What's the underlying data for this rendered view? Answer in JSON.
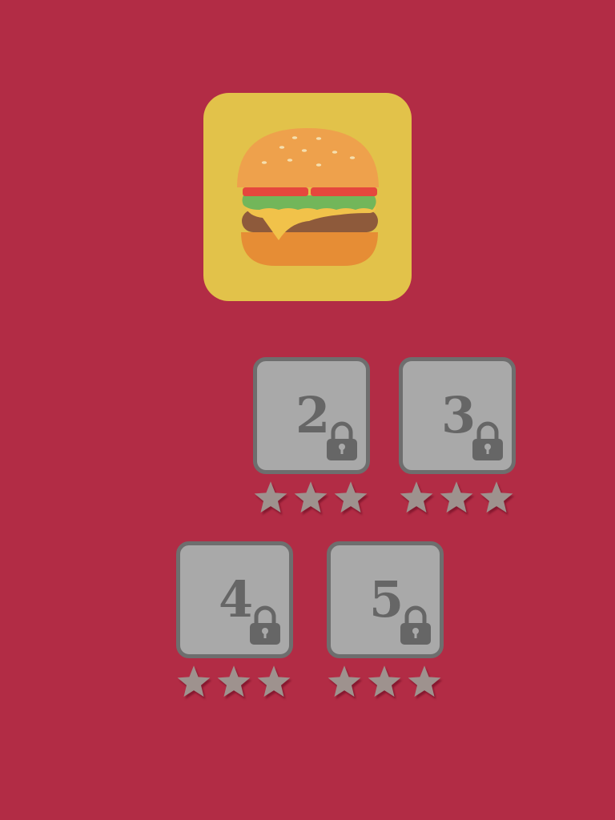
{
  "app_icon": {
    "name": "burger-icon"
  },
  "levels": [
    {
      "number": "2",
      "locked": true,
      "stars_earned": 0,
      "stars_total": 3
    },
    {
      "number": "3",
      "locked": true,
      "stars_earned": 0,
      "stars_total": 3
    },
    {
      "number": "4",
      "locked": true,
      "stars_earned": 0,
      "stars_total": 3
    },
    {
      "number": "5",
      "locked": true,
      "stars_earned": 0,
      "stars_total": 3
    }
  ],
  "colors": {
    "background": "#b22c45",
    "icon_background": "#e2c24a",
    "tile_fill": "#a9a9a9",
    "tile_border": "#6e6e6e",
    "tile_text": "#666666",
    "star_empty": "#9e928e"
  }
}
